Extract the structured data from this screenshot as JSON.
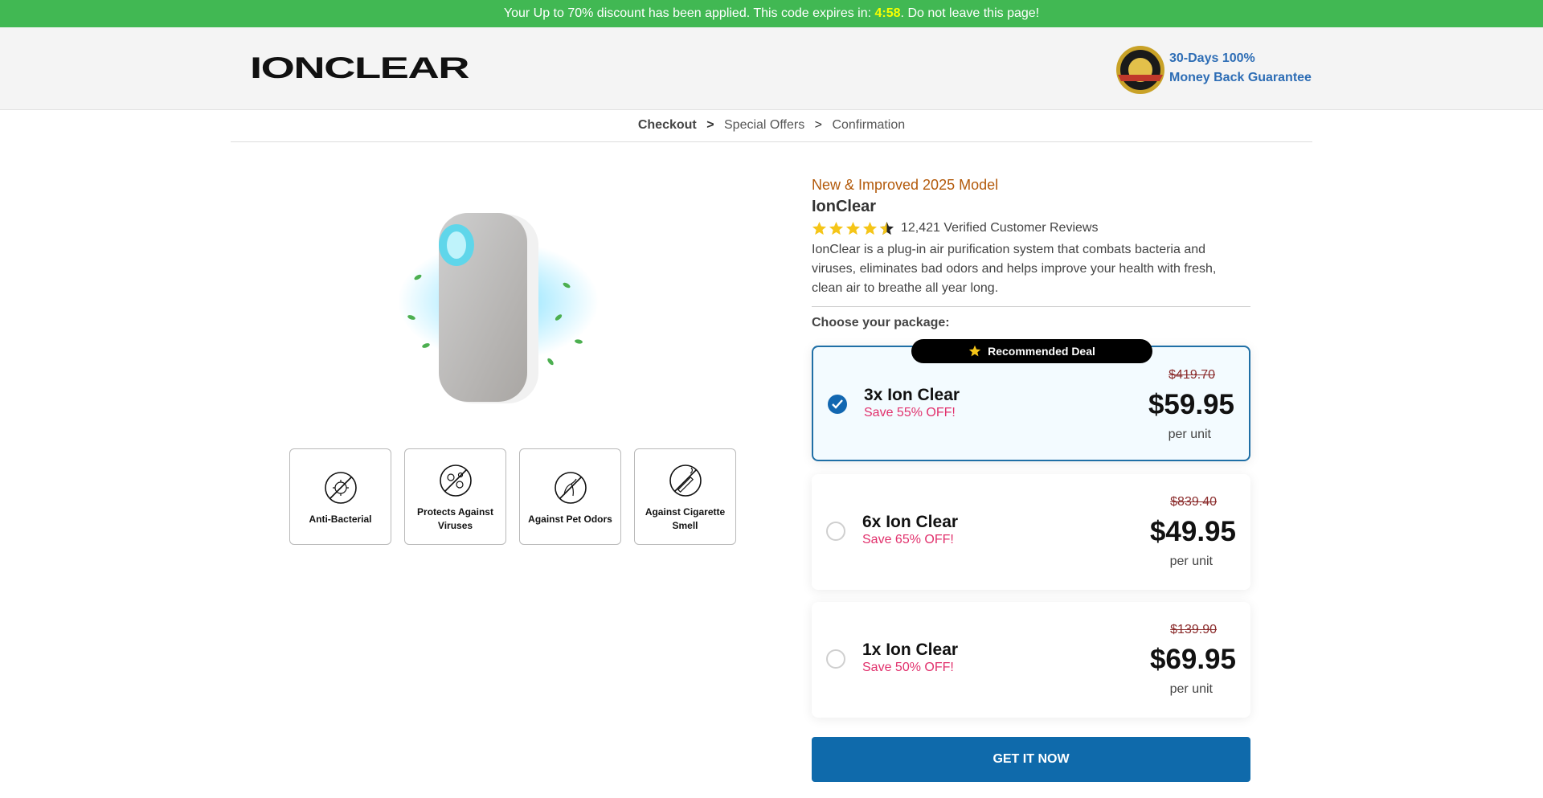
{
  "topbar": {
    "prefix": "Your Up to 70% discount has been applied. This code expires in: ",
    "timer": "4:58",
    "suffix": ". Do not leave this page!"
  },
  "header": {
    "logo_text": "IONCLEAR",
    "guarantee_line1": "30-Days 100%",
    "guarantee_line2": "Money Back Guarantee"
  },
  "breadcrumb": [
    "Checkout",
    "Special Offers",
    "Confirmation"
  ],
  "features": [
    {
      "label": "Anti-Bacterial",
      "icon": "no-bacteria-icon"
    },
    {
      "label": "Protects Against Viruses",
      "icon": "no-virus-icon"
    },
    {
      "label": "Against Pet Odors",
      "icon": "no-pet-icon"
    },
    {
      "label": "Against Cigarette Smell",
      "icon": "no-smoking-icon"
    }
  ],
  "product": {
    "model": "New & Improved 2025 Model",
    "name": "IonClear",
    "rating": 4.5,
    "reviews": "12,421 Verified Customer Reviews",
    "description": "IonClear is a plug-in air purification system that combats bacteria and viruses, eliminates bad odors and helps improve your health with fresh, clean air to breathe all year long.",
    "choose_label": "Choose your package:"
  },
  "packages": [
    {
      "name": "3x Ion Clear",
      "save": "Save 55% OFF!",
      "old_price": "$419.70",
      "price": "$59.95",
      "unit": "per unit",
      "selected": true,
      "ribbon": "Recommended Deal"
    },
    {
      "name": "6x Ion Clear",
      "save": "Save 65% OFF!",
      "old_price": "$839.40",
      "price": "$49.95",
      "unit": "per unit",
      "selected": false
    },
    {
      "name": "1x Ion Clear",
      "save": "Save 50% OFF!",
      "old_price": "$139.90",
      "price": "$69.95",
      "unit": "per unit",
      "selected": false
    }
  ],
  "cta": {
    "label": "GET IT NOW"
  },
  "colors": {
    "topbar": "#41b853",
    "timer": "#f8ff00",
    "accent": "#0f6aab",
    "save": "#e1306c",
    "model": "#b35a0b"
  }
}
